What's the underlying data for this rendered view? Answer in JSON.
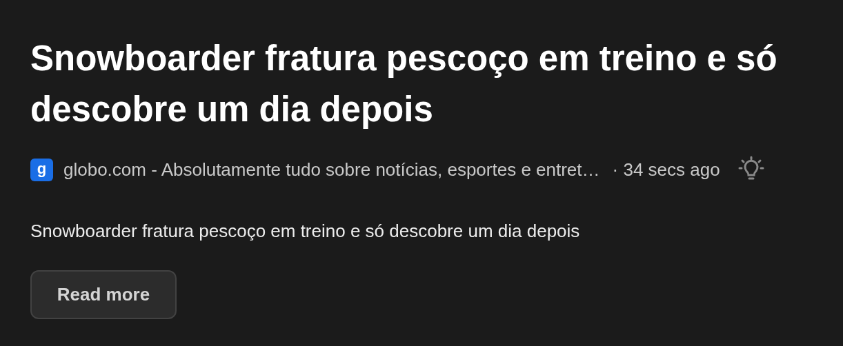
{
  "headline": "Snowboarder fratura pescoço em treino e só descobre um dia depois",
  "source": {
    "favicon": "g",
    "name": "globo.com - Absolutamente tudo sobre notícias, esportes e entret…",
    "time": "· 34 secs ago"
  },
  "summary": "Snowboarder fratura pescoço em treino e só descobre um dia depois",
  "buttons": [
    "Read more"
  ]
}
